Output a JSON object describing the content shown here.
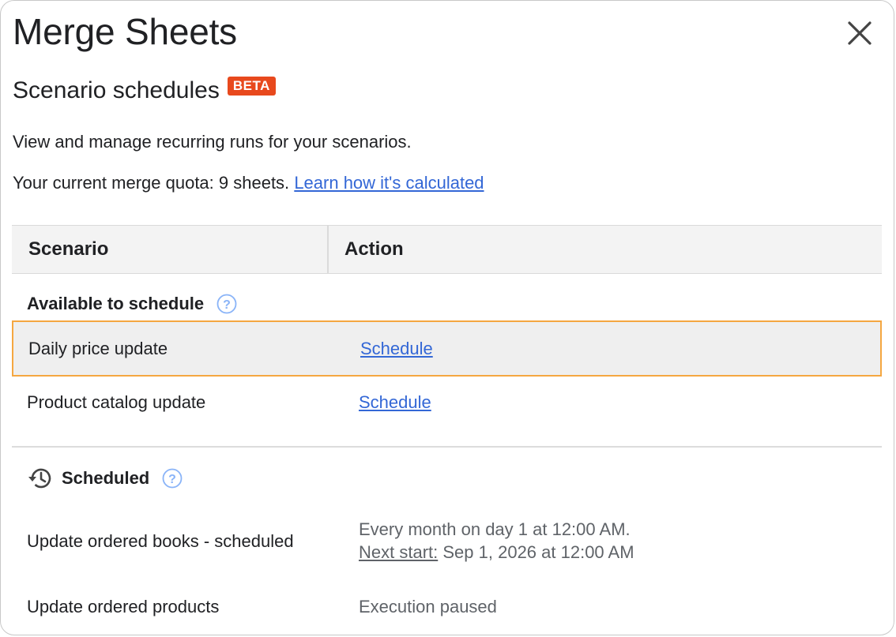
{
  "dialog": {
    "title": "Merge Sheets",
    "close_icon": "close-icon"
  },
  "header": {
    "subtitle": "Scenario schedules",
    "badge": "BETA",
    "badge_color": "#e8491d",
    "description": "View and manage recurring runs for your scenarios.",
    "quota_text": "Your current merge quota: 9 sheets.",
    "quota_link": "Learn how it's calculated"
  },
  "table": {
    "columns": [
      "Scenario",
      "Action"
    ]
  },
  "available": {
    "heading": "Available to schedule",
    "help_icon": "help-circle-icon",
    "rows": [
      {
        "name": "Daily price update",
        "action": "Schedule",
        "selected": true
      },
      {
        "name": "Product catalog update",
        "action": "Schedule",
        "selected": false
      }
    ]
  },
  "scheduled": {
    "heading": "Scheduled",
    "icon": "history-icon",
    "help_icon": "help-circle-icon",
    "rows": [
      {
        "name": "Update ordered books - scheduled",
        "frequency": "Every month on day 1 at 12:00 AM.",
        "next_label": "Next start:",
        "next_value": "Sep 1, 2026 at 12:00 AM"
      },
      {
        "name": "Update ordered products",
        "status": "Execution paused"
      }
    ]
  },
  "colors": {
    "link": "#3367d6",
    "selected_border": "#f5a741",
    "header_bg": "#f3f3f3",
    "help_icon": "#8ab4f8"
  }
}
